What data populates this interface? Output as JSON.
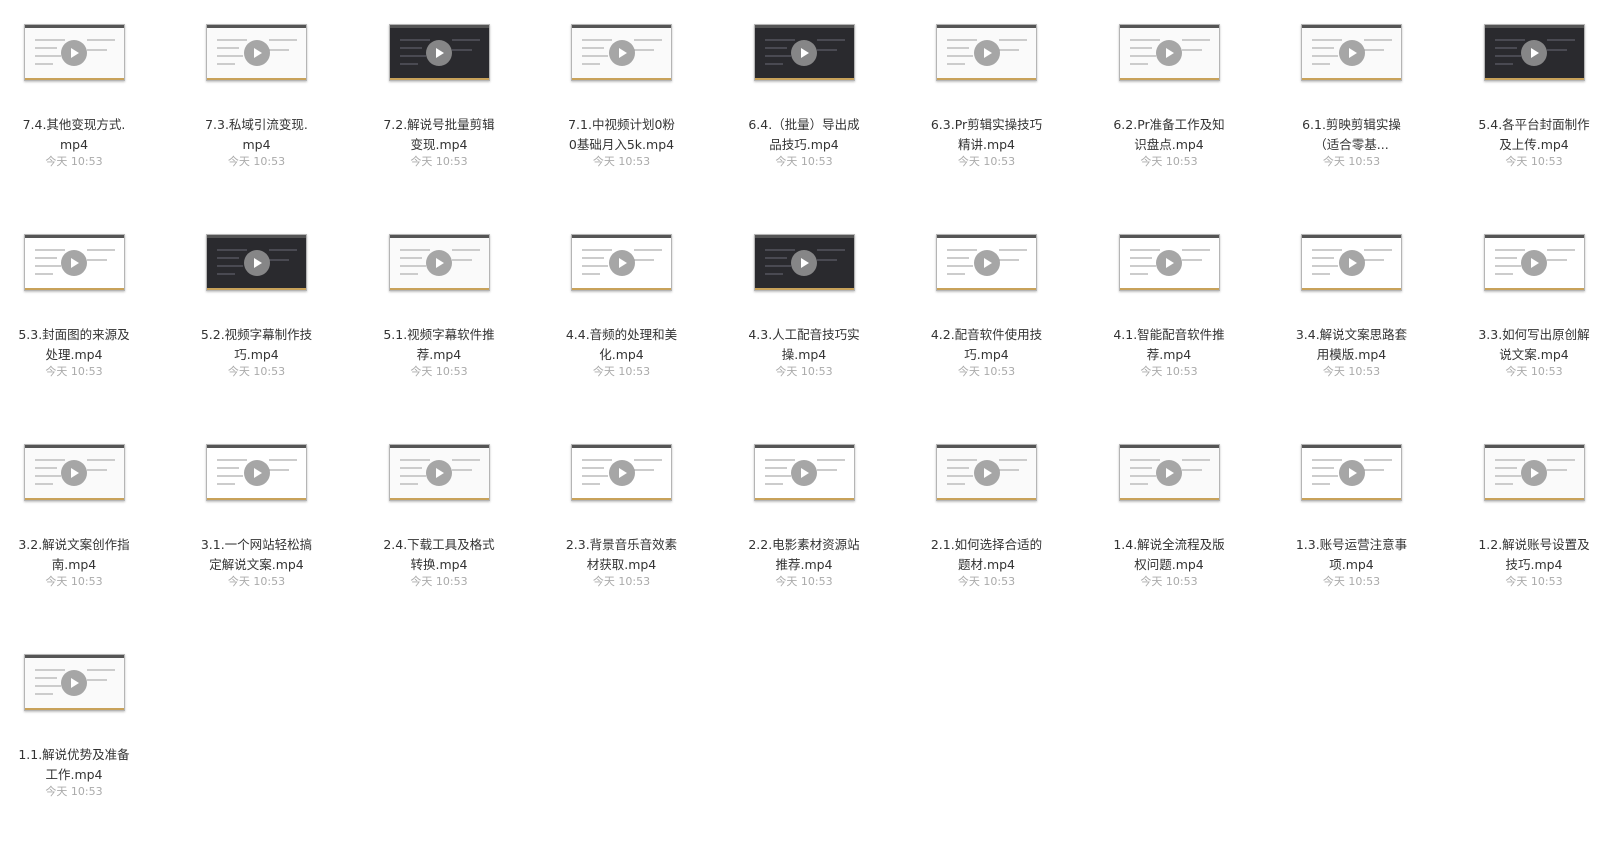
{
  "files": [
    {
      "name": "7.4.其他变现方式.mp4",
      "time": "今天 10:53",
      "style": "light"
    },
    {
      "name": "7.3.私域引流变现.mp4",
      "time": "今天 10:53",
      "style": "light"
    },
    {
      "name": "7.2.解说号批量剪辑变现.mp4",
      "time": "今天 10:53",
      "style": "dark"
    },
    {
      "name": "7.1.中视频计划0粉0基础月入5k.mp4",
      "time": "今天 10:53",
      "style": "light"
    },
    {
      "name": "6.4.（批量）导出成品技巧.mp4",
      "time": "今天 10:53",
      "style": "dark"
    },
    {
      "name": "6.3.Pr剪辑实操技巧精讲.mp4",
      "time": "今天 10:53",
      "style": "light"
    },
    {
      "name": "6.2.Pr准备工作及知识盘点.mp4",
      "time": "今天 10:53",
      "style": "light"
    },
    {
      "name": "6.1.剪映剪辑实操（适合零基...",
      "time": "今天 10:53",
      "style": "light"
    },
    {
      "name": "5.4.各平台封面制作及上传.mp4",
      "time": "今天 10:53",
      "style": "dark"
    },
    {
      "name": "5.3.封面图的来源及处理.mp4",
      "time": "今天 10:53",
      "style": "web"
    },
    {
      "name": "5.2.视频字幕制作技巧.mp4",
      "time": "今天 10:53",
      "style": "dark"
    },
    {
      "name": "5.1.视频字幕软件推荐.mp4",
      "time": "今天 10:53",
      "style": "light"
    },
    {
      "name": "4.4.音频的处理和美化.mp4",
      "time": "今天 10:53",
      "style": "web"
    },
    {
      "name": "4.3.人工配音技巧实操.mp4",
      "time": "今天 10:53",
      "style": "dark"
    },
    {
      "name": "4.2.配音软件使用技巧.mp4",
      "time": "今天 10:53",
      "style": "web"
    },
    {
      "name": "4.1.智能配音软件推荐.mp4",
      "time": "今天 10:53",
      "style": "web"
    },
    {
      "name": "3.4.解说文案思路套用模版.mp4",
      "time": "今天 10:53",
      "style": "web"
    },
    {
      "name": "3.3.如何写出原创解说文案.mp4",
      "time": "今天 10:53",
      "style": "web"
    },
    {
      "name": "3.2.解说文案创作指南.mp4",
      "time": "今天 10:53",
      "style": "light"
    },
    {
      "name": "3.1.一个网站轻松搞定解说文案.mp4",
      "time": "今天 10:53",
      "style": "web"
    },
    {
      "name": "2.4.下载工具及格式转换.mp4",
      "time": "今天 10:53",
      "style": "light"
    },
    {
      "name": "2.3.背景音乐音效素材获取.mp4",
      "time": "今天 10:53",
      "style": "web"
    },
    {
      "name": "2.2.电影素材资源站推荐.mp4",
      "time": "今天 10:53",
      "style": "web"
    },
    {
      "name": "2.1.如何选择合适的题材.mp4",
      "time": "今天 10:53",
      "style": "light"
    },
    {
      "name": "1.4.解说全流程及版权问题.mp4",
      "time": "今天 10:53",
      "style": "light"
    },
    {
      "name": "1.3.账号运营注意事项.mp4",
      "time": "今天 10:53",
      "style": "web"
    },
    {
      "name": "1.2.解说账号设置及技巧.mp4",
      "time": "今天 10:53",
      "style": "light"
    },
    {
      "name": "1.1.解说优势及准备工作.mp4",
      "time": "今天 10:53",
      "style": "light"
    }
  ],
  "play_icon": "play-icon"
}
